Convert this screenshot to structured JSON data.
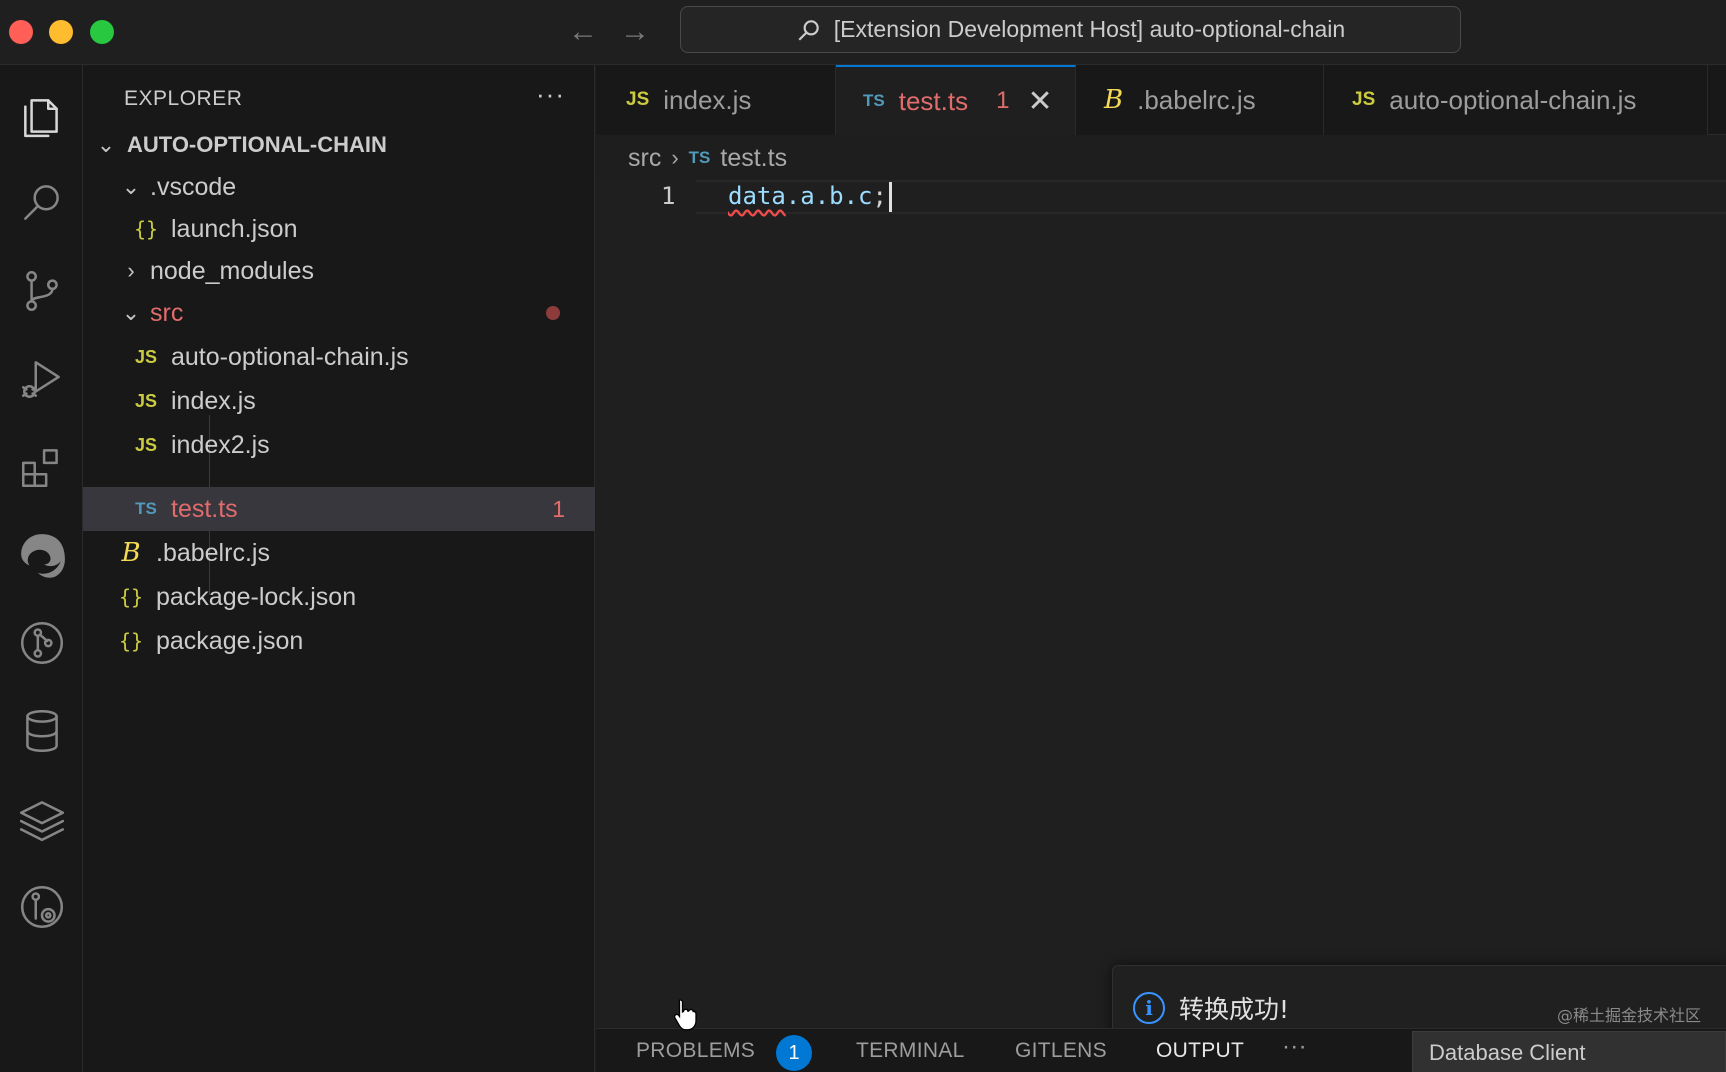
{
  "titlebar": {
    "command_center": "[Extension Development Host] auto-optional-chain"
  },
  "sidebar": {
    "title": "EXPLORER",
    "more": "···",
    "root": "AUTO-OPTIONAL-CHAIN",
    "items": [
      {
        "label": ".vscode",
        "type": "folder-open"
      },
      {
        "label": "launch.json",
        "type": "json",
        "icon": "{}"
      },
      {
        "label": "node_modules",
        "type": "folder-closed"
      },
      {
        "label": "src",
        "type": "folder-open"
      },
      {
        "label": "auto-optional-chain.js",
        "type": "js",
        "icon": "JS"
      },
      {
        "label": "index.js",
        "type": "js",
        "icon": "JS"
      },
      {
        "label": "index2.js",
        "type": "js",
        "icon": "JS"
      },
      {
        "label": "test.ts",
        "type": "ts",
        "icon": "TS",
        "badge": "1"
      },
      {
        "label": ".babelrc.js",
        "type": "babel",
        "icon": "B"
      },
      {
        "label": "package-lock.json",
        "type": "json",
        "icon": "{}"
      },
      {
        "label": "package.json",
        "type": "json",
        "icon": "{}"
      }
    ]
  },
  "tabs": [
    {
      "label": "index.js",
      "icon": "JS"
    },
    {
      "label": "test.ts",
      "icon": "TS",
      "badge": "1",
      "close": "✕"
    },
    {
      "label": ".babelrc.js",
      "icon": "B"
    },
    {
      "label": "auto-optional-chain.js",
      "icon": "JS"
    }
  ],
  "breadcrumb": {
    "folder": "src",
    "sep": "›",
    "file_icon": "TS",
    "file": "test.ts"
  },
  "editor": {
    "line_number": "1",
    "code_ident": "data",
    "code_rest": ".a.b.c",
    "code_semi": ";"
  },
  "notification": {
    "icon": "i",
    "message": "转换成功!",
    "watermark": "@稀土掘金技术社区"
  },
  "panel": {
    "problems": "PROBLEMS",
    "problems_badge": "1",
    "terminal": "TERMINAL",
    "gitlens": "GITLENS",
    "output": "OUTPUT",
    "more": "···",
    "output_channel": "Database Client"
  },
  "colors": {
    "accent": "#0078d4",
    "error": "#e06c6c",
    "js": "#cbcb41",
    "ts": "#519aba"
  }
}
